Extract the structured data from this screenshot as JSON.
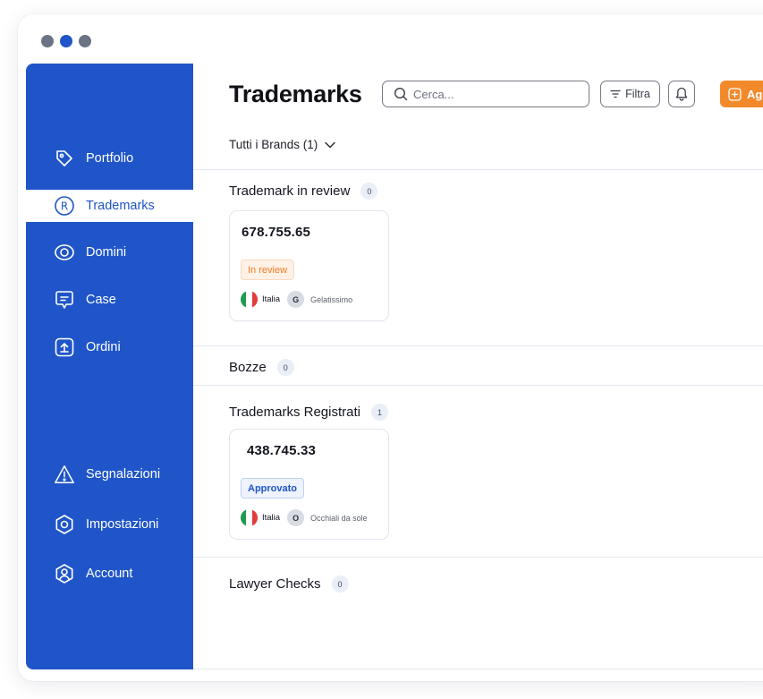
{
  "window": {
    "dot_colors": [
      "#6b7385",
      "#1f55c8",
      "#6b7385"
    ]
  },
  "sidebar": {
    "items": [
      {
        "label": "Portfolio",
        "icon": "tag-icon",
        "active": false
      },
      {
        "label": "Trademarks",
        "icon": "registered-icon",
        "active": true
      },
      {
        "label": "Domini",
        "icon": "eye-icon",
        "active": false
      },
      {
        "label": "Case",
        "icon": "chat-icon",
        "active": false
      },
      {
        "label": "Ordini",
        "icon": "upload-icon",
        "active": false
      },
      {
        "label": "Segnalazioni",
        "icon": "warning-icon",
        "active": false
      },
      {
        "label": "Impostazioni",
        "icon": "gear-icon",
        "active": false
      },
      {
        "label": "Account",
        "icon": "user-icon",
        "active": false
      }
    ]
  },
  "header": {
    "title": "Trademarks",
    "search_placeholder": "Cerca...",
    "filter_label": "Filtra",
    "add_label": "Aggiungi",
    "brand_filter": "Tutti i Brands (1)"
  },
  "sections": [
    {
      "title": "Trademark in review",
      "count": "0",
      "cards": [
        {
          "number": "678.755.65",
          "status": "In review",
          "country": "Italia",
          "brand_initial": "G",
          "brand": "Gelatissimo"
        }
      ]
    },
    {
      "title": "Bozze",
      "count": "0",
      "cards": []
    },
    {
      "title": "Trademarks Registrati",
      "count": "1",
      "cards": [
        {
          "number": "438.745.33",
          "status": "Approvato",
          "country": "Italia",
          "brand_initial": "O",
          "brand": "Occhiali da sole"
        }
      ]
    },
    {
      "title": "Lawyer Checks",
      "count": "0",
      "cards": []
    }
  ],
  "colors": {
    "primary": "#1f55c8",
    "accent": "#f28a2c",
    "review_text": "#ef7b22",
    "flag_italy": [
      "#1f9a4e",
      "#ffffff",
      "#e23b3b"
    ]
  }
}
